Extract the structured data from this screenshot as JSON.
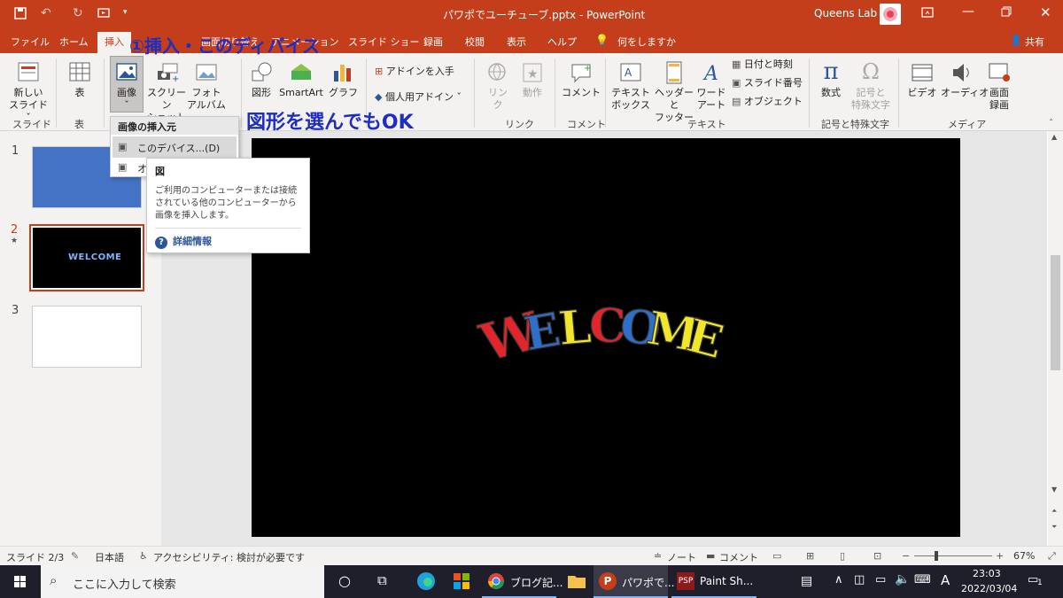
{
  "window": {
    "title": "パワポでユーチューブ.pptx - PowerPoint",
    "user": "Queens Lab"
  },
  "tabs": [
    {
      "label": "ファイル"
    },
    {
      "label": "ホーム"
    },
    {
      "label": "挿入",
      "active": true
    },
    {
      "label": "画面切り替え"
    },
    {
      "label": "アニメーション"
    },
    {
      "label": "スライド ショー"
    },
    {
      "label": "録画"
    },
    {
      "label": "校閲"
    },
    {
      "label": "表示"
    },
    {
      "label": "ヘルプ"
    },
    {
      "label": "何をしますか"
    }
  ],
  "share_label": "共有",
  "ribbon": {
    "new_slide": "新しい\nスライド",
    "table": "表",
    "image": "画像",
    "screenshot": "スクリーン\nショット",
    "photo_album": "フォト\nアルバム",
    "shapes": "図形",
    "smartart": "SmartArt",
    "chart": "グラフ",
    "get_addins": "アドインを入手",
    "my_addins": "個人用アドイン",
    "link": "リン\nク",
    "action": "動作",
    "comment": "コメント",
    "textbox": "テキスト\nボックス",
    "header_footer": "ヘッダーと\nフッター",
    "wordart": "ワード\nアート",
    "date_time": "日付と時刻",
    "slide_number": "スライド番号",
    "object": "オブジェクト",
    "equation": "数式",
    "symbol": "記号と\n特殊文字",
    "video": "ビデオ",
    "audio": "オーディオ",
    "screen_rec": "画面\n録画",
    "groups": {
      "slides": "スライド",
      "tables": "表",
      "links": "リンク",
      "comments": "コメント",
      "text": "テキスト",
      "symbols": "記号と特殊文字",
      "media": "メディア"
    }
  },
  "dropdown": {
    "header": "画像の挿入元",
    "item_device": "このデバイス...(D)",
    "item_online": "オ"
  },
  "tooltip": {
    "title": "図",
    "body": "ご利用のコンピューターまたは接続されている他のコンピューターから画像を挿入します。",
    "link": "詳細情報"
  },
  "annotations": {
    "note1": "①挿入・このディバイス",
    "note2": "図形を選んでもOK"
  },
  "slides": [
    {
      "num": "1"
    },
    {
      "num": "2",
      "thumb_text": "WELCOME"
    },
    {
      "num": "3"
    }
  ],
  "slide_main": {
    "letters": [
      {
        "ch": "W",
        "color": "#e0262b"
      },
      {
        "ch": "E",
        "color": "#2f6fc9"
      },
      {
        "ch": "L",
        "color": "#f2e62a"
      },
      {
        "ch": "C",
        "color": "#e0262b"
      },
      {
        "ch": "O",
        "color": "#2f6fc9"
      },
      {
        "ch": "M",
        "color": "#f2e62a"
      },
      {
        "ch": "E",
        "color": "#f2e62a"
      }
    ]
  },
  "statusbar": {
    "slide_info": "スライド 2/3",
    "language": "日本語",
    "accessibility": "アクセシビリティ: 検討が必要です",
    "notes": "ノート",
    "comments": "コメント",
    "zoom": "67%"
  },
  "taskbar": {
    "search_placeholder": "ここに入力して検索",
    "apps": [
      {
        "label": "ブログ記..."
      },
      {
        "label": "パワポで..."
      },
      {
        "label": "Paint Sh..."
      }
    ],
    "ime": "A",
    "time": "23:03",
    "date": "2022/03/04",
    "notif_count": "1"
  }
}
